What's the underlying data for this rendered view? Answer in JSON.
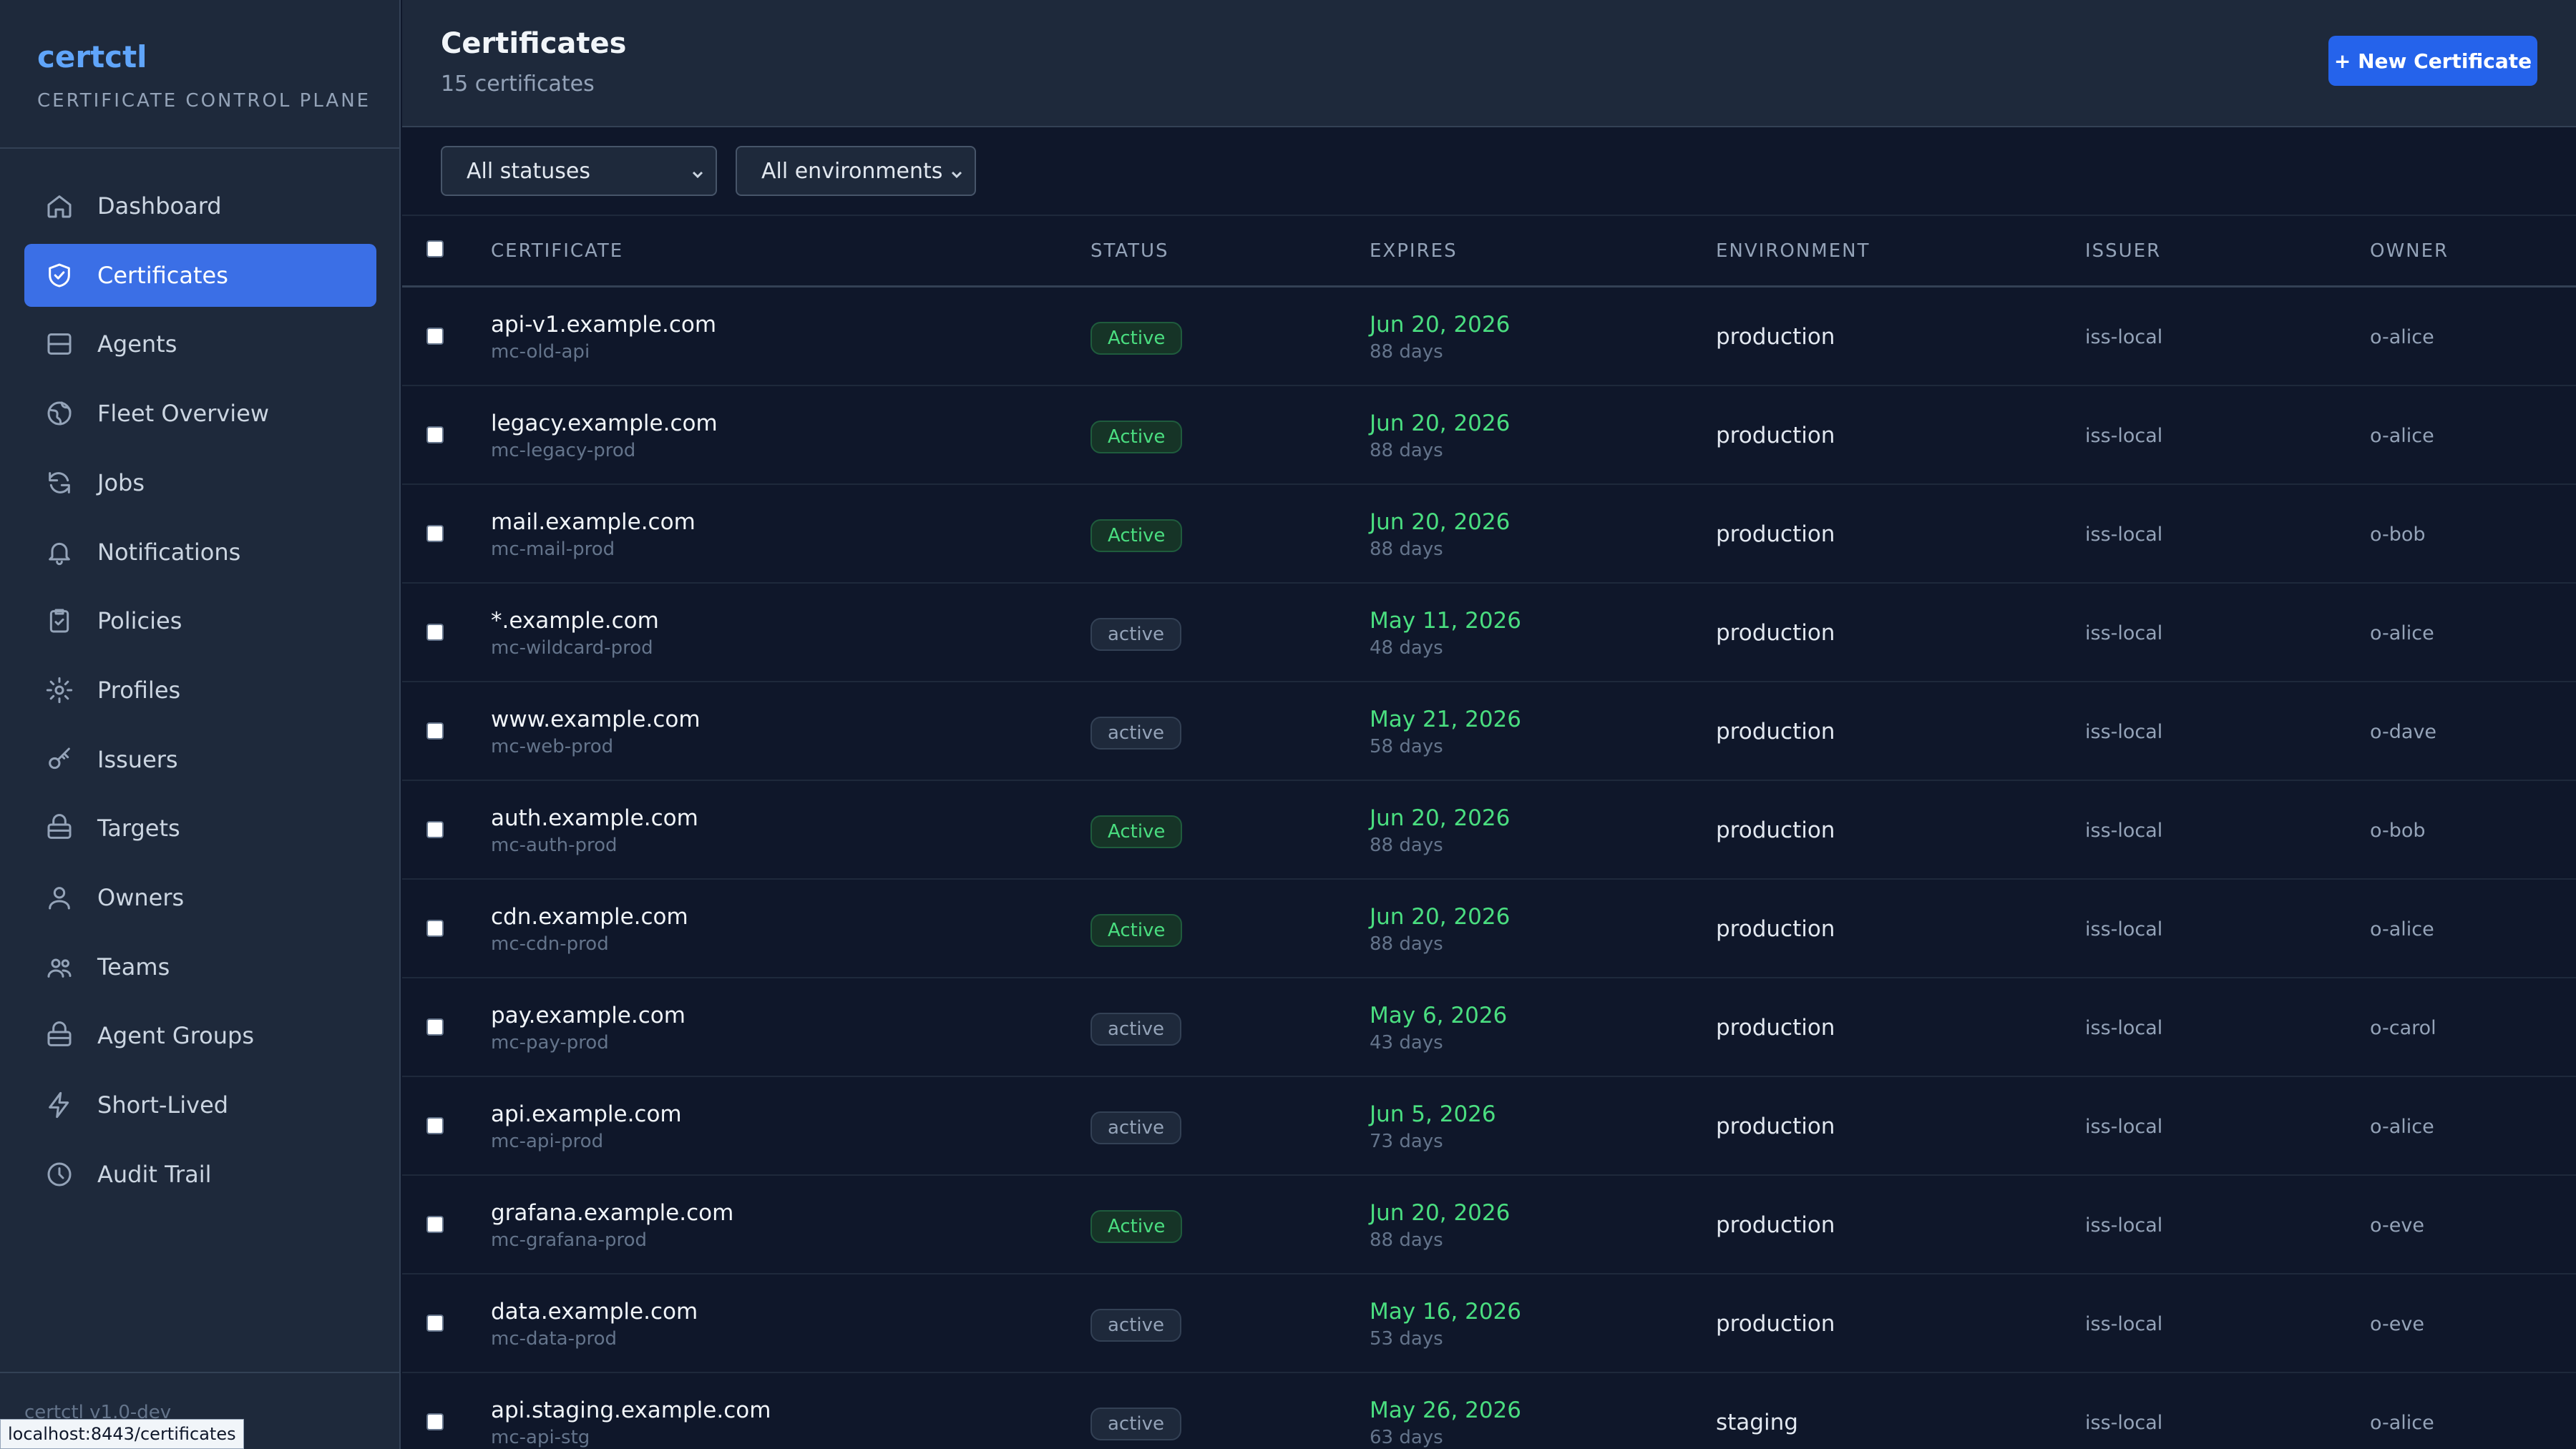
{
  "app": {
    "name": "certctl",
    "subtitle": "CERTIFICATE CONTROL PLANE",
    "version": "certctl v1.0-dev"
  },
  "status_bar_url": "localhost:8443/certificates",
  "sidebar": {
    "items": [
      {
        "label": "Dashboard",
        "icon": "home-icon",
        "active": false
      },
      {
        "label": "Certificates",
        "icon": "shield-icon",
        "active": true
      },
      {
        "label": "Agents",
        "icon": "server-icon",
        "active": false
      },
      {
        "label": "Fleet Overview",
        "icon": "globe-icon",
        "active": false
      },
      {
        "label": "Jobs",
        "icon": "refresh-icon",
        "active": false
      },
      {
        "label": "Notifications",
        "icon": "bell-icon",
        "active": false
      },
      {
        "label": "Policies",
        "icon": "clipboard-check-icon",
        "active": false
      },
      {
        "label": "Profiles",
        "icon": "gear-icon",
        "active": false
      },
      {
        "label": "Issuers",
        "icon": "key-icon",
        "active": false
      },
      {
        "label": "Targets",
        "icon": "stack-icon",
        "active": false
      },
      {
        "label": "Owners",
        "icon": "user-icon",
        "active": false
      },
      {
        "label": "Teams",
        "icon": "users-icon",
        "active": false
      },
      {
        "label": "Agent Groups",
        "icon": "stack-icon",
        "active": false
      },
      {
        "label": "Short-Lived",
        "icon": "bolt-icon",
        "active": false
      },
      {
        "label": "Audit Trail",
        "icon": "clock-icon",
        "active": false
      }
    ]
  },
  "header": {
    "title": "Certificates",
    "count": "15 certificates",
    "new_button": "+ New Certificate"
  },
  "filters": {
    "status": "All statuses",
    "environment": "All environments"
  },
  "table": {
    "columns": [
      "CERTIFICATE",
      "STATUS",
      "EXPIRES",
      "ENVIRONMENT",
      "ISSUER",
      "OWNER"
    ],
    "rows": [
      {
        "name": "api-v1.example.com",
        "id": "mc-old-api",
        "status": "Active",
        "status_style": "green",
        "expires": "Jun 20, 2026",
        "days": "88 days",
        "env": "production",
        "issuer": "iss-local",
        "owner": "o-alice"
      },
      {
        "name": "legacy.example.com",
        "id": "mc-legacy-prod",
        "status": "Active",
        "status_style": "green",
        "expires": "Jun 20, 2026",
        "days": "88 days",
        "env": "production",
        "issuer": "iss-local",
        "owner": "o-alice"
      },
      {
        "name": "mail.example.com",
        "id": "mc-mail-prod",
        "status": "Active",
        "status_style": "green",
        "expires": "Jun 20, 2026",
        "days": "88 days",
        "env": "production",
        "issuer": "iss-local",
        "owner": "o-bob"
      },
      {
        "name": "*.example.com",
        "id": "mc-wildcard-prod",
        "status": "active",
        "status_style": "gray",
        "expires": "May 11, 2026",
        "days": "48 days",
        "env": "production",
        "issuer": "iss-local",
        "owner": "o-alice"
      },
      {
        "name": "www.example.com",
        "id": "mc-web-prod",
        "status": "active",
        "status_style": "gray",
        "expires": "May 21, 2026",
        "days": "58 days",
        "env": "production",
        "issuer": "iss-local",
        "owner": "o-dave"
      },
      {
        "name": "auth.example.com",
        "id": "mc-auth-prod",
        "status": "Active",
        "status_style": "green",
        "expires": "Jun 20, 2026",
        "days": "88 days",
        "env": "production",
        "issuer": "iss-local",
        "owner": "o-bob"
      },
      {
        "name": "cdn.example.com",
        "id": "mc-cdn-prod",
        "status": "Active",
        "status_style": "green",
        "expires": "Jun 20, 2026",
        "days": "88 days",
        "env": "production",
        "issuer": "iss-local",
        "owner": "o-alice"
      },
      {
        "name": "pay.example.com",
        "id": "mc-pay-prod",
        "status": "active",
        "status_style": "gray",
        "expires": "May 6, 2026",
        "days": "43 days",
        "env": "production",
        "issuer": "iss-local",
        "owner": "o-carol"
      },
      {
        "name": "api.example.com",
        "id": "mc-api-prod",
        "status": "active",
        "status_style": "gray",
        "expires": "Jun 5, 2026",
        "days": "73 days",
        "env": "production",
        "issuer": "iss-local",
        "owner": "o-alice"
      },
      {
        "name": "grafana.example.com",
        "id": "mc-grafana-prod",
        "status": "Active",
        "status_style": "green",
        "expires": "Jun 20, 2026",
        "days": "88 days",
        "env": "production",
        "issuer": "iss-local",
        "owner": "o-eve"
      },
      {
        "name": "data.example.com",
        "id": "mc-data-prod",
        "status": "active",
        "status_style": "gray",
        "expires": "May 16, 2026",
        "days": "53 days",
        "env": "production",
        "issuer": "iss-local",
        "owner": "o-eve"
      },
      {
        "name": "api.staging.example.com",
        "id": "mc-api-stg",
        "status": "active",
        "status_style": "gray",
        "expires": "May 26, 2026",
        "days": "63 days",
        "env": "staging",
        "issuer": "iss-local",
        "owner": "o-alice"
      }
    ]
  }
}
